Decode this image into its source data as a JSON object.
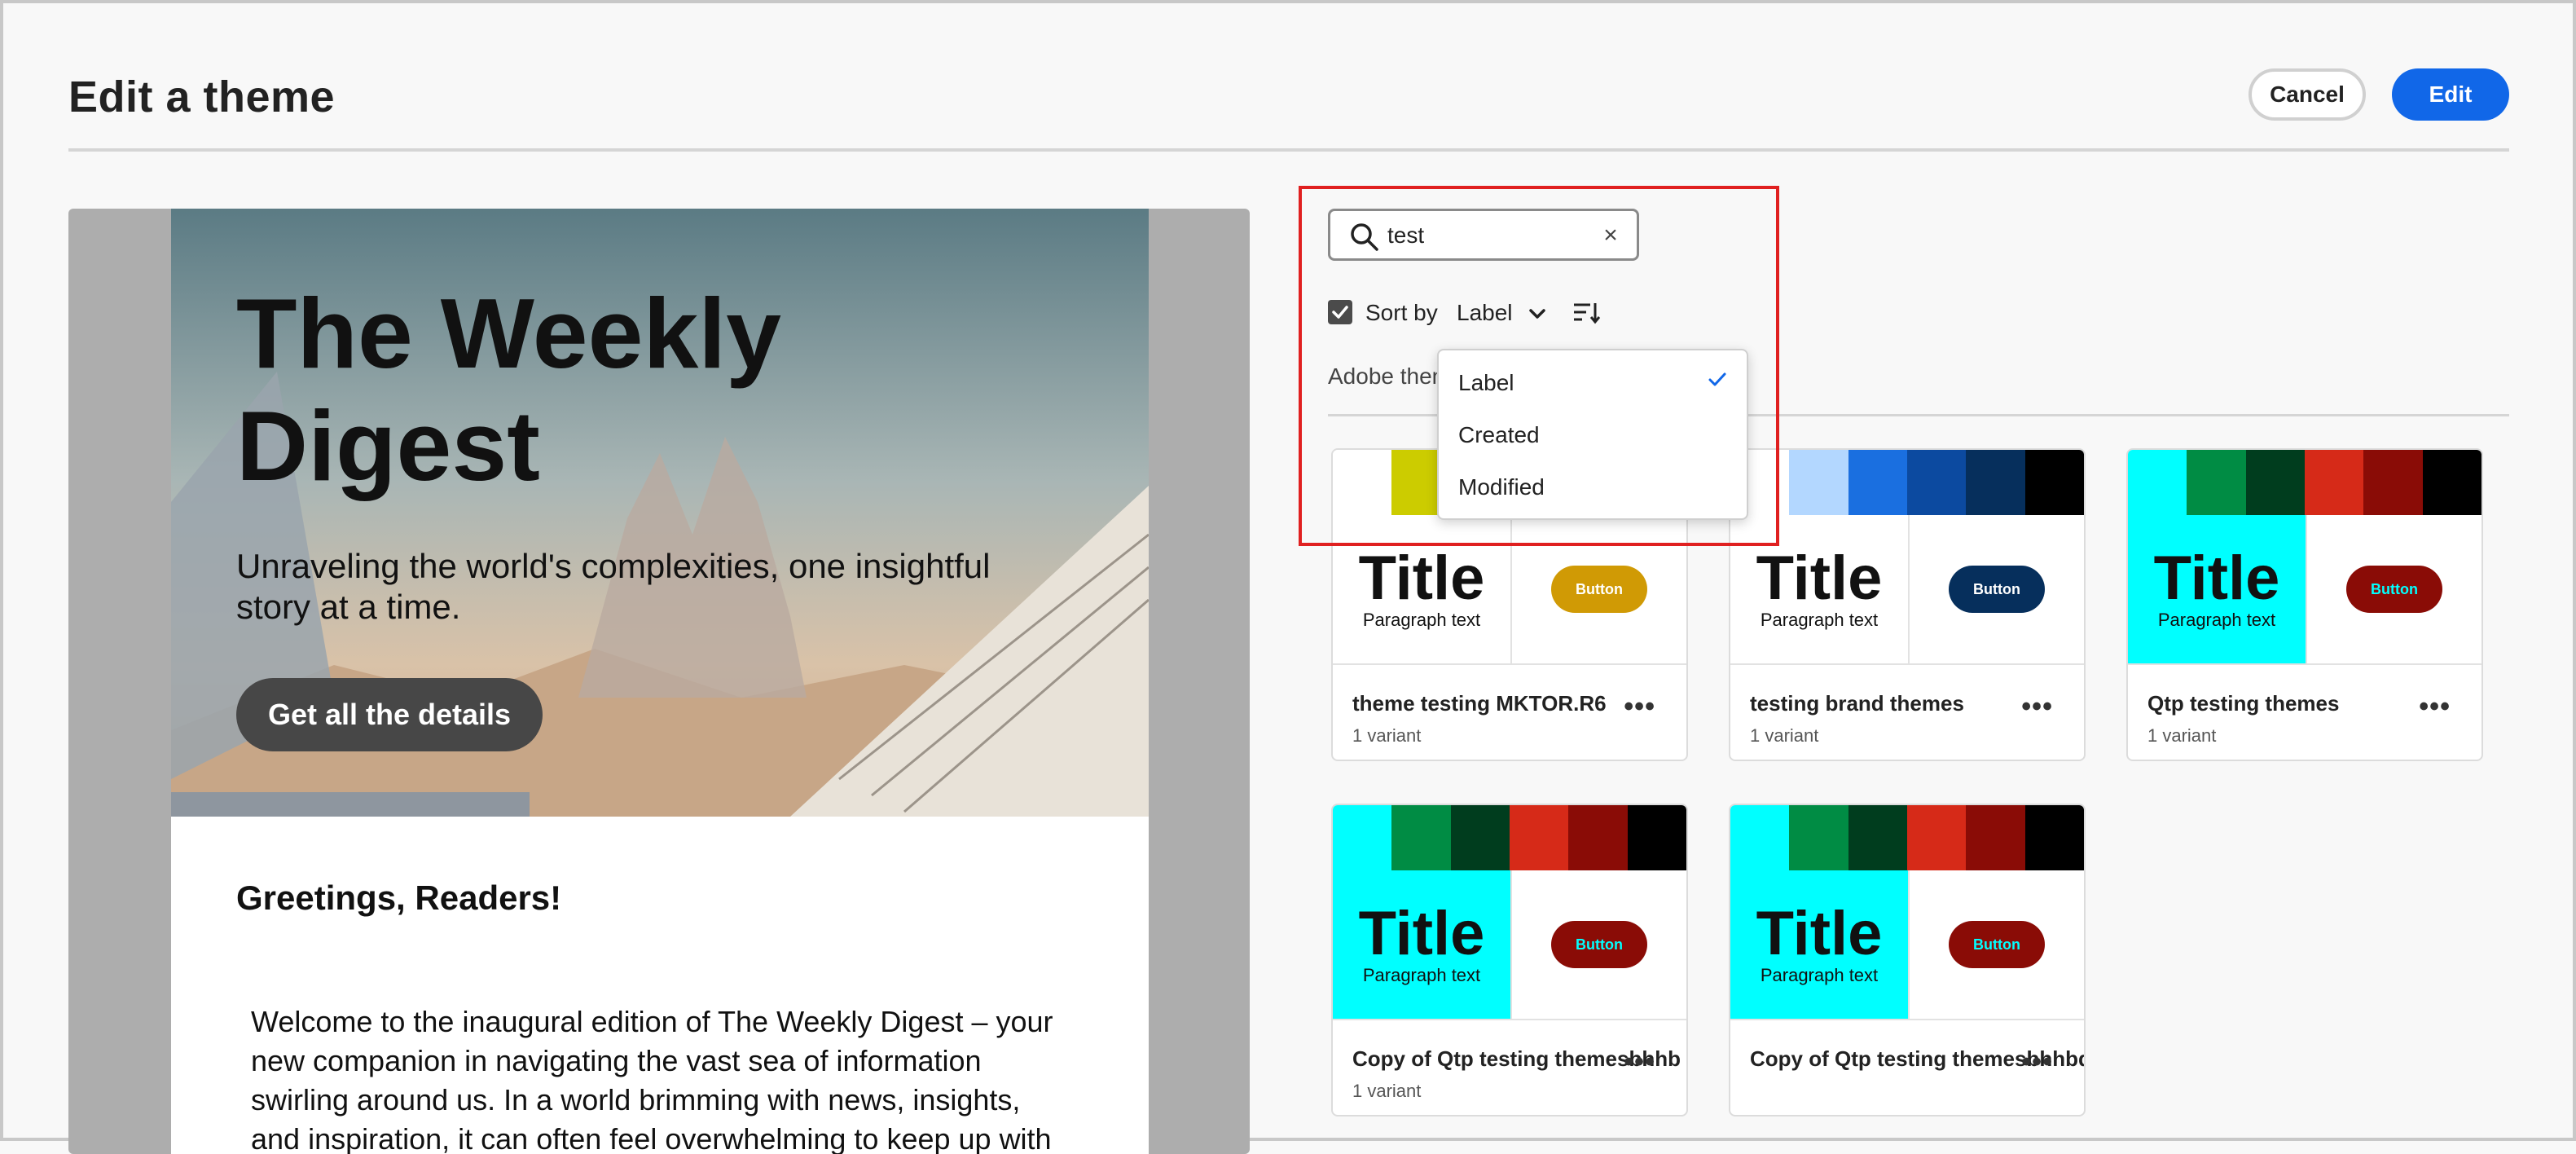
{
  "header": {
    "title": "Edit a theme",
    "cancel_label": "Cancel",
    "edit_label": "Edit"
  },
  "preview": {
    "title": "The Weekly Digest",
    "subtitle": "Unraveling the world's complexities, one insightful story at a time.",
    "cta": "Get all the details",
    "greeting": "Greetings, Readers!",
    "body": "Welcome to the inaugural edition of The Weekly Digest – your new companion in navigating the vast sea of information swirling around us. In a world brimming with news, insights, and inspiration, it can often feel overwhelming to keep up with"
  },
  "search": {
    "value": "test",
    "icon": "search-icon",
    "clear_icon": "close-icon"
  },
  "sort": {
    "checked": true,
    "label": "Sort by",
    "selected": "Label",
    "options": [
      "Label",
      "Created",
      "Modified"
    ]
  },
  "section_label": "Adobe them",
  "cards": [
    {
      "name": "theme testing MKTOR.R6",
      "meta": "1 variant",
      "swatches": [
        "#ffffff",
        "#cccc00",
        "#ffffff",
        "#ffffff",
        "#ffffff",
        "#ffffff"
      ],
      "title": "Title",
      "para": "Paragraph text",
      "button": "Button",
      "btn_bg": "#d09a05",
      "btn_fg": "#ffffff",
      "left_bg": "#ffffff"
    },
    {
      "name": "testing brand themes",
      "meta": "1 variant",
      "swatches": [
        "#ffffff",
        "#b3d7ff",
        "#1a6fe0",
        "#0c4aa0",
        "#062f5c",
        "#000000"
      ],
      "title": "Title",
      "para": "Paragraph text",
      "button": "Button",
      "btn_bg": "#062f5c",
      "btn_fg": "#ffffff",
      "left_bg": "#ffffff"
    },
    {
      "name": "Qtp testing themes",
      "meta": "1 variant",
      "swatches": [
        "#00ffff",
        "#008c44",
        "#003d1e",
        "#d62a18",
        "#8a0c06",
        "#000000"
      ],
      "title": "Title",
      "para": "Paragraph text",
      "button": "Button",
      "btn_bg": "#8a0c06",
      "btn_fg": "#00ffff",
      "left_bg": "#00ffff"
    },
    {
      "name": "Copy of Qtp testing themesbhhb",
      "meta": "1 variant",
      "swatches": [
        "#00ffff",
        "#008c44",
        "#003d1e",
        "#d62a18",
        "#8a0c06",
        "#000000"
      ],
      "title": "Title",
      "para": "Paragraph text",
      "button": "Button",
      "btn_bg": "#8a0c06",
      "btn_fg": "#00ffff",
      "left_bg": "#00ffff"
    },
    {
      "name": "Copy of Qtp testing themesbhhbdqe",
      "meta": "",
      "swatches": [
        "#00ffff",
        "#008c44",
        "#003d1e",
        "#d62a18",
        "#8a0c06",
        "#000000"
      ],
      "title": "Title",
      "para": "Paragraph text",
      "button": "Button",
      "btn_bg": "#8a0c06",
      "btn_fg": "#00ffff",
      "left_bg": "#00ffff"
    }
  ],
  "colors": {
    "accent": "#1167e8",
    "highlight": "#e02020"
  }
}
